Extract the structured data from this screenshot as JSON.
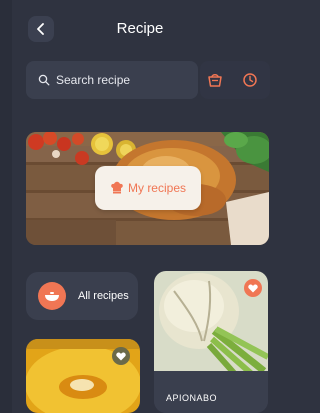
{
  "header": {
    "title": "Recipe",
    "back_icon": "chevron-left-icon"
  },
  "search": {
    "placeholder": "Search recipe",
    "icon": "search-icon"
  },
  "tools": {
    "cart_icon": "basket-icon",
    "history_icon": "clock-icon",
    "accent": "#f07654"
  },
  "hero": {
    "button_label": "My recipes",
    "button_icon": "chef-hat-icon"
  },
  "categories": {
    "all_label": "All recipes",
    "all_icon": "bowl-icon"
  },
  "cards": [
    {
      "name": "APIONABO",
      "favorite_icon": "heart-icon"
    },
    {
      "name": "",
      "favorite_icon": "heart-icon"
    }
  ],
  "colors": {
    "background": "#2f3340",
    "surface": "#3a3f4e",
    "accent": "#f07654",
    "text": "#ffffff"
  }
}
